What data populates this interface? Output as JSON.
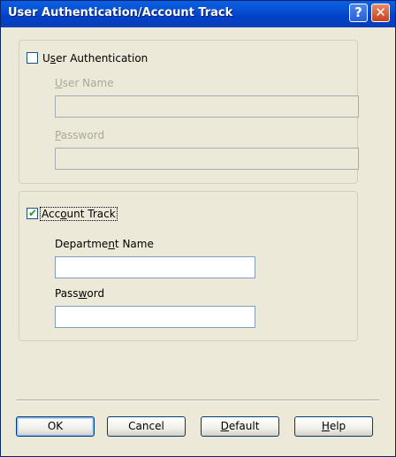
{
  "window": {
    "title": "User Authentication/Account Track",
    "help_glyph": "?",
    "close_glyph": "✕"
  },
  "user_auth": {
    "checkbox_label_pre": "U",
    "checkbox_label_ul": "s",
    "checkbox_label_post": "er Authentication",
    "checked": false,
    "username_label_ul": "U",
    "username_label_rest": "ser Name",
    "username_value": "",
    "password_label_ul": "P",
    "password_label_rest": "assword",
    "password_value": ""
  },
  "account_track": {
    "checkbox_label_pre": "Acc",
    "checkbox_label_ul": "o",
    "checkbox_label_post": "unt Track",
    "checked": true,
    "check_glyph": "✔",
    "department_label_pre": "Departme",
    "department_label_ul": "n",
    "department_label_post": "t Name",
    "department_value": "",
    "password_label_pre": "Pass",
    "password_label_ul": "w",
    "password_label_post": "ord",
    "password_value": ""
  },
  "buttons": {
    "ok": "OK",
    "cancel": "Cancel",
    "default_ul": "D",
    "default_rest": "efault",
    "help_ul": "H",
    "help_rest": "elp"
  }
}
